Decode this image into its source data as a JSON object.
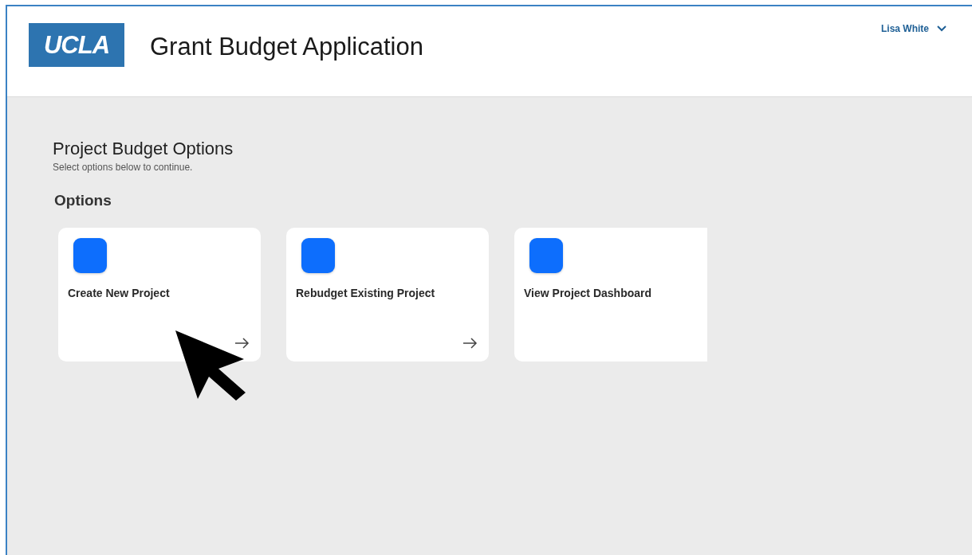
{
  "header": {
    "logo": "UCLA",
    "title": "Grant Budget Application",
    "user": {
      "name": "Lisa White"
    }
  },
  "page": {
    "title": "Project Budget Options",
    "subtitle": "Select options below to continue."
  },
  "options": {
    "heading": "Options",
    "cards": [
      {
        "label": "Create New Project",
        "arrow": true,
        "clipped": false
      },
      {
        "label": "Rebudget Existing Project",
        "arrow": true,
        "clipped": false
      },
      {
        "label": "View Project Dashboard",
        "arrow": false,
        "clipped": true
      }
    ]
  }
}
